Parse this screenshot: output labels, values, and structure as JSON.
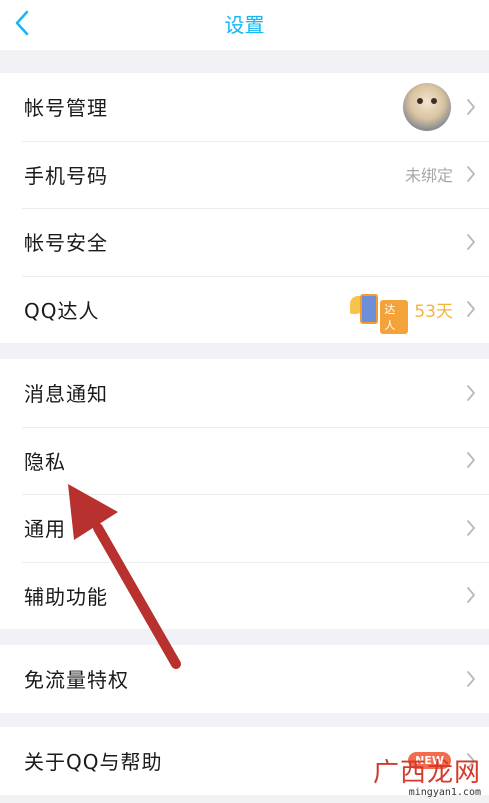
{
  "header": {
    "title": "设置",
    "back_icon": "chevron-left-icon"
  },
  "colors": {
    "accent": "#12b7f5",
    "arrow": "#b8312f",
    "days": "#f4b43c",
    "new_badge": "#f46b4d"
  },
  "groups": [
    {
      "rows": [
        {
          "label": "帐号管理",
          "right": {
            "type": "avatar"
          }
        },
        {
          "label": "手机号码",
          "right": {
            "type": "text",
            "value": "未绑定"
          }
        },
        {
          "label": "帐号安全"
        },
        {
          "label": "QQ达人",
          "right": {
            "type": "badge",
            "badge_text": "达人",
            "value": "53天"
          }
        }
      ]
    },
    {
      "rows": [
        {
          "label": "消息通知"
        },
        {
          "label": "隐私"
        },
        {
          "label": "通用"
        },
        {
          "label": "辅助功能"
        }
      ]
    },
    {
      "rows": [
        {
          "label": "免流量特权"
        }
      ]
    },
    {
      "rows": [
        {
          "label": "关于QQ与帮助",
          "right": {
            "type": "new",
            "value": "NEW"
          }
        }
      ]
    }
  ],
  "watermark": {
    "logo": "广西龙网",
    "url": "mingyan1.com"
  }
}
